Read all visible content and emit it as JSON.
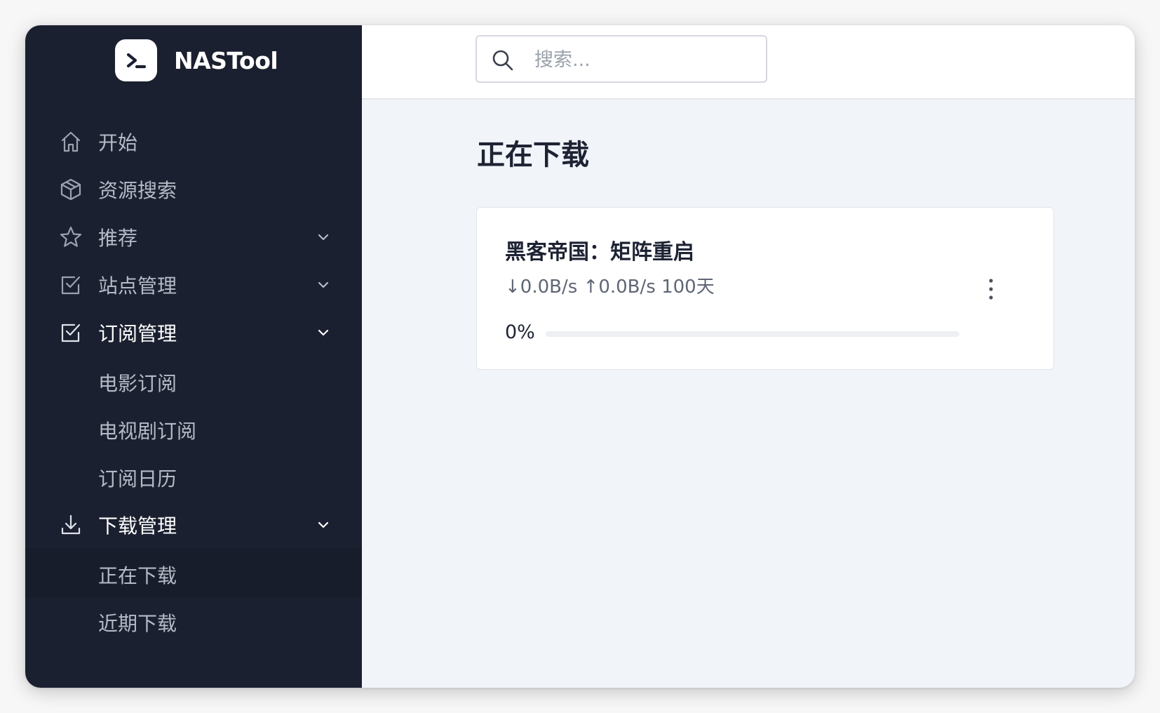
{
  "app": {
    "name": "NASTool"
  },
  "sidebar": {
    "items": [
      {
        "label": "开始",
        "icon": "home-icon"
      },
      {
        "label": "资源搜索",
        "icon": "cube-icon"
      },
      {
        "label": "推荐",
        "icon": "star-icon",
        "expandable": true
      },
      {
        "label": "站点管理",
        "icon": "checkbox-icon",
        "expandable": true
      },
      {
        "label": "订阅管理",
        "icon": "checkbox-icon",
        "expandable": true,
        "expanded": true,
        "children": [
          "电影订阅",
          "电视剧订阅",
          "订阅日历"
        ]
      },
      {
        "label": "下载管理",
        "icon": "download-icon",
        "expandable": true,
        "expanded": true,
        "children": [
          "正在下载",
          "近期下载"
        ]
      }
    ]
  },
  "search": {
    "placeholder": "搜索..."
  },
  "page": {
    "title": "正在下载"
  },
  "downloads": [
    {
      "title": "黑客帝国：矩阵重启",
      "stats": "↓0.0B/s ↑0.0B/s 100天",
      "progress_label": "0%",
      "progress": 0
    }
  ],
  "colors": {
    "sidebar_bg": "#1b2030",
    "content_bg": "#f1f4f9",
    "text_dark": "#1d2333",
    "nav_text": "#b4bac6"
  }
}
